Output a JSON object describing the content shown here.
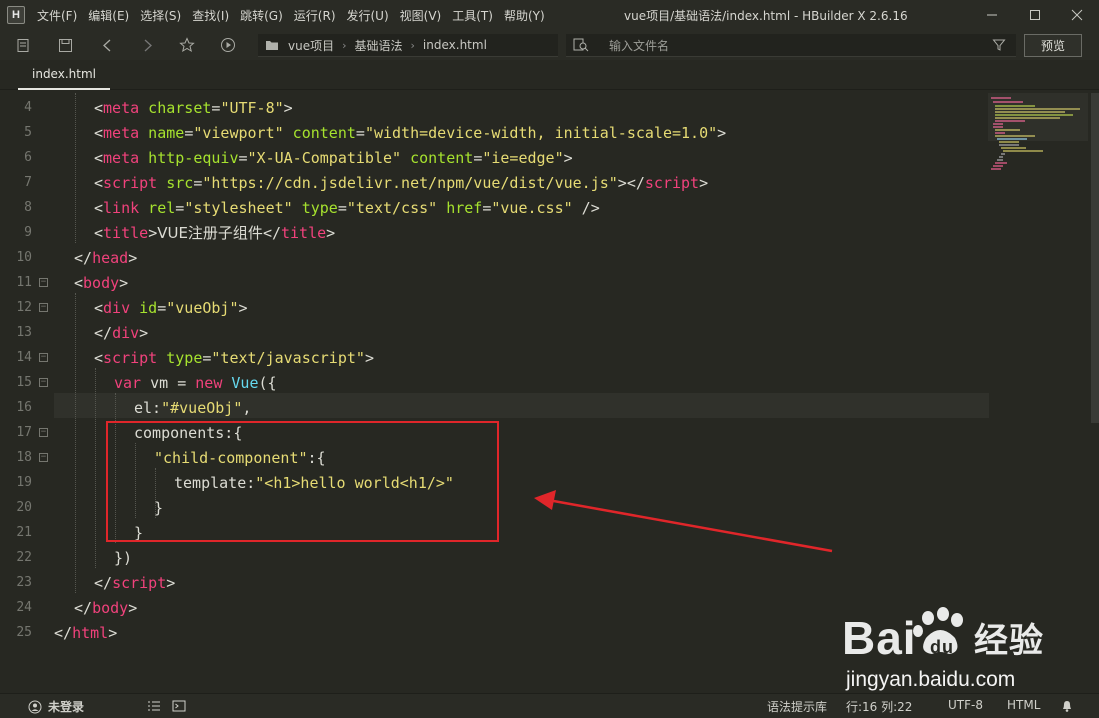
{
  "titlebar": {
    "logo": "H",
    "menu": [
      "文件(F)",
      "编辑(E)",
      "选择(S)",
      "查找(I)",
      "跳转(G)",
      "运行(R)",
      "发行(U)",
      "视图(V)",
      "工具(T)",
      "帮助(Y)"
    ],
    "title": "vue项目/基础语法/index.html - HBuilder X 2.6.16"
  },
  "toolbar": {
    "breadcrumb": [
      "vue项目",
      "基础语法",
      "index.html"
    ],
    "file_search_placeholder": "输入文件名",
    "preview_label": "预览"
  },
  "tab": {
    "label": "index.html"
  },
  "editor": {
    "current_line": 16,
    "lines": [
      {
        "n": "4"
      },
      {
        "n": "5"
      },
      {
        "n": "6"
      },
      {
        "n": "7"
      },
      {
        "n": "8"
      },
      {
        "n": "9"
      },
      {
        "n": "10"
      },
      {
        "n": "11"
      },
      {
        "n": "12"
      },
      {
        "n": "13"
      },
      {
        "n": "14"
      },
      {
        "n": "15"
      },
      {
        "n": "16"
      },
      {
        "n": "17"
      },
      {
        "n": "18"
      },
      {
        "n": "19"
      },
      {
        "n": "20"
      },
      {
        "n": "21"
      },
      {
        "n": "22"
      },
      {
        "n": "23"
      },
      {
        "n": "24"
      },
      {
        "n": "25"
      }
    ],
    "code": {
      "l4": [
        "<",
        "meta",
        " charset",
        "=",
        "\"UTF-8\"",
        ">"
      ],
      "l5": [
        "<",
        "meta",
        " name",
        "=",
        "\"viewport\"",
        " content",
        "=",
        "\"width=device-width, initial-scale=1.0\"",
        ">"
      ],
      "l6": [
        "<",
        "meta",
        " http-equiv",
        "=",
        "\"X-UA-Compatible\"",
        " content",
        "=",
        "\"ie=edge\"",
        ">"
      ],
      "l7": [
        "<",
        "script",
        " src",
        "=",
        "\"https://cdn.jsdelivr.net/npm/vue/dist/vue.js\"",
        "></",
        "script",
        ">"
      ],
      "l8": [
        "<",
        "link",
        " rel",
        "=",
        "\"stylesheet\"",
        " type",
        "=",
        "\"text/css\"",
        " href",
        "=",
        "\"vue.css\"",
        " />"
      ],
      "l9": [
        "<",
        "title",
        ">",
        "VUE注册子组件",
        "</",
        "title",
        ">"
      ],
      "l10": [
        "</",
        "head",
        ">"
      ],
      "l11": [
        "<",
        "body",
        ">"
      ],
      "l12": [
        "<",
        "div",
        " id",
        "=",
        "\"vueObj\"",
        ">"
      ],
      "l13": [
        "</",
        "div",
        ">"
      ],
      "l14": [
        "<",
        "script",
        " type",
        "=",
        "\"text/javascript\"",
        ">"
      ],
      "l15": [
        "var",
        " vm = ",
        "new",
        " ",
        "Vue",
        "({"
      ],
      "l16": [
        "el:",
        "\"#vueObj\"",
        ","
      ],
      "l17": [
        "components:{"
      ],
      "l18": [
        "\"child-component\"",
        ":{"
      ],
      "l19": [
        "template:",
        "\"<h1>hello world<h1/>\""
      ],
      "l20": [
        "}"
      ],
      "l21": [
        "}"
      ],
      "l22": [
        "})"
      ],
      "l23": [
        "</",
        "script",
        ">"
      ],
      "l24": [
        "</",
        "body",
        ">"
      ],
      "l25": [
        "</",
        "html",
        ">"
      ]
    }
  },
  "watermark": {
    "brand": "Bai du 经验",
    "url": "jingyan.baidu.com"
  },
  "statusbar": {
    "login": "未登录",
    "syntax_hint": "语法提示库",
    "position": "行:16  列:22",
    "encoding": "UTF-8",
    "language": "HTML"
  },
  "colors": {
    "tag": "#f0427c",
    "attr": "#a6e22e",
    "string": "#e6db74",
    "keyword": "#f0427c",
    "builtin": "#66d9ef",
    "annotation": "#e0262a"
  }
}
